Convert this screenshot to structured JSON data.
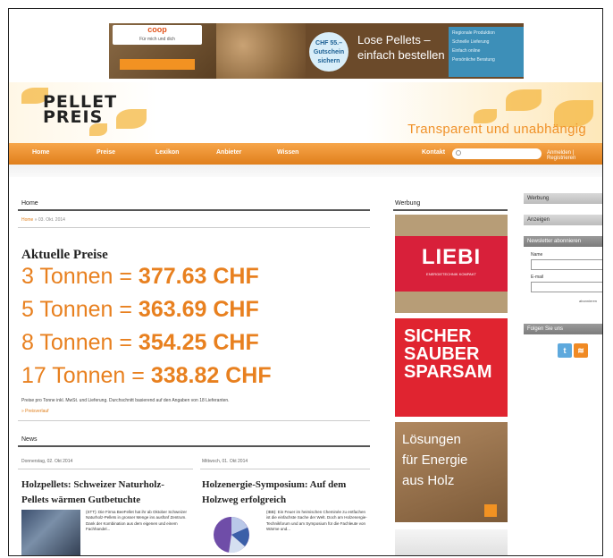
{
  "banner": {
    "brand": "coop",
    "brand_sub": "Für mich und dich",
    "badge": "CHF 55.– Gutschein sichern",
    "slogan": "Lose Pellets – einfach bestellen",
    "checks": [
      "Regionale Produktion",
      "Schnelle Lieferung",
      "Einfach online",
      "Persönliche Beratung"
    ]
  },
  "site": {
    "logo_line1": "PELLET",
    "logo_line2": "PREIS",
    "tagline": "Transparent und unabhängig"
  },
  "nav": {
    "items": [
      "Home",
      "Preise",
      "Lexikon",
      "Anbieter",
      "Wissen"
    ],
    "kontakt": "Kontakt",
    "search_placeholder": "",
    "right_links": "Anmelden | Registrieren"
  },
  "main": {
    "section_title": "Home",
    "breadcrumb_home": "Home",
    "breadcrumb_rest": "» 03. Okt. 2014",
    "heading": "Aktuelle Preise",
    "prices": [
      {
        "qty": "3 Tonnen = ",
        "value": "377.63 CHF"
      },
      {
        "qty": "5 Tonnen = ",
        "value": "363.69 CHF"
      },
      {
        "qty": "8 Tonnen = ",
        "value": "354.25 CHF"
      },
      {
        "qty": "17 Tonnen = ",
        "value": "338.82 CHF"
      }
    ],
    "note": "Preise pro Tonne inkl. MwSt. und Lieferung. Durchschnitt basierend auf den Angaben von 18 Lieferanten.",
    "note_link": "» Preisverlauf",
    "news_section": "News",
    "news": [
      {
        "date": "Donnerstag, 02. Okt 2014",
        "title": "Holzpellets: Schweizer Naturholz-Pellets wärmen Gutbetuchte",
        "body": "(STT): Die Firma BeeFellet hat ihr ab Oktober Schweizer Naturholz-Pellets in grosser Menge ins ausfünf Zentrum. Dank der Kombination aus dem eigenen und einem Fachhandel..."
      },
      {
        "date": "Mittwoch, 01. Okt 2014",
        "title": "Holzenergie-Symposium: Auf dem Holzweg erfolgreich",
        "body": "(IBB): Ein Feuer im heimischen Cheminée zu entfachen ist die einfachste Sache der Welt. Doch am Holzenergie-Technikforum und am Symposium für die Fachleute von Wärme und..."
      }
    ]
  },
  "ads": {
    "column_title": "Werbung",
    "liebi": "LIEBI",
    "liebi_sub": "ENERGIETECHNIK KOMPAKT",
    "sicher": [
      "SICHER",
      "SAUBER",
      "SPARSAM"
    ],
    "holz": [
      "Lösungen",
      "für Energie",
      "aus Holz"
    ]
  },
  "sidebar": {
    "werbung": "Werbung",
    "anzeigen": "Anzeigen",
    "login_title": "Newsletter abonnieren",
    "name_label": "Name",
    "email_label": "E-mail",
    "check_label": "abonnieren",
    "follow_title": "Folgen Sie uns"
  }
}
